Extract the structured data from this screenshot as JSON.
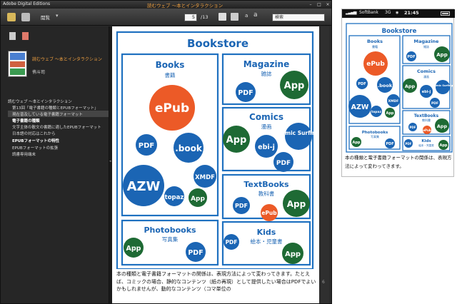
{
  "window": {
    "app_title": "Adobe Digital Editions",
    "book_title": "読むウェブ ～本とインタラクション"
  },
  "toolbar": {
    "view_mode": "閲覧",
    "page_current": "5",
    "page_total": "/13",
    "font_small": "a",
    "font_large": "a",
    "search_placeholder": "検索"
  },
  "sidebar": {
    "book_title": "読むウェブ ～本とインタラクション",
    "author": "侑斗司",
    "toc": [
      "読むウェブ ～本とインタラクション",
      "第13回「電子書籍の種類とEPUBフォーマット」",
      "現在普及している電子書籍フォーマット",
      "電子書籍の種類",
      "文字主体の散文の書籍に適したEPUBフォーマット",
      "日本語の対応はこれから",
      "EPUBフォーマットの特性",
      "EPUBフォーマットの拡張",
      "読書専用端末"
    ]
  },
  "diagram": {
    "title": "Bookstore",
    "books": {
      "title": "Books",
      "subtitle": "書籍",
      "items": [
        "ePub",
        "PDF",
        ".book",
        "AZW",
        "topaz",
        "XMDF",
        "App"
      ]
    },
    "magazine": {
      "title": "Magazine",
      "subtitle": "雑誌",
      "items": [
        "PDF",
        "App"
      ]
    },
    "comics": {
      "title": "Comics",
      "subtitle": "漫画",
      "items": [
        "App",
        "ebi-j",
        "Comic Surfing",
        "PDF"
      ]
    },
    "textbooks": {
      "title": "TextBooks",
      "subtitle": "教科書",
      "items": [
        "PDF",
        "ePub",
        "App"
      ]
    },
    "photobooks": {
      "title": "Photobooks",
      "subtitle": "写真集",
      "items": [
        "App",
        "PDF"
      ]
    },
    "kids": {
      "title": "Kids",
      "subtitle": "絵本・児童書",
      "items": [
        "PDF",
        "App"
      ]
    },
    "colors": {
      "blue": "#1b65b4",
      "green": "#1e6a34",
      "orange": "#ec5a27",
      "border": "#1f71c0"
    }
  },
  "main_caption": "本の種類と電子書籍フォーマットの関係は、表現方法によって変わってきます。たとえば、コミックの場合、静的なコンテンツ（紙の再現）として提供したい場合はPDFでよいかもしれませんが、動的なコンテンツ（コマ単位の",
  "iphone": {
    "carrier": "SoftBank",
    "network": "3G",
    "time": "21:45",
    "caption": "本の種類と電子書籍フォーマットの関係は、表現方法によって変わってきます。"
  }
}
